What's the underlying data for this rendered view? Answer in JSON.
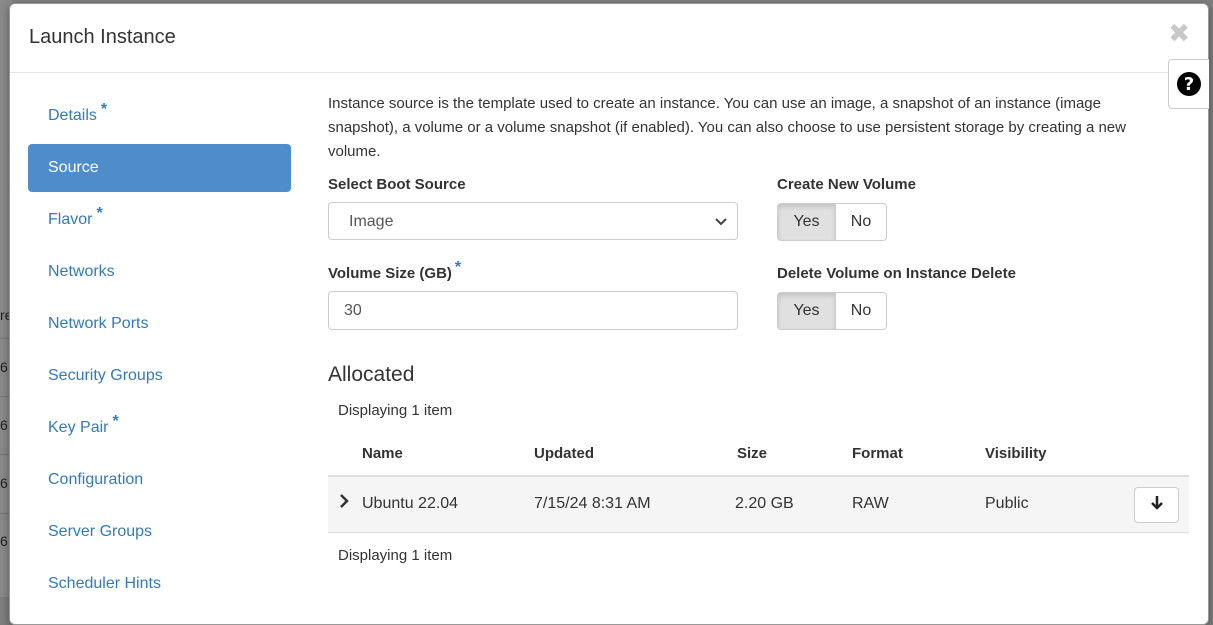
{
  "background": {
    "fragments": [
      "re",
      "6.",
      "6.",
      "6.",
      "6."
    ]
  },
  "modal": {
    "title": "Launch Instance",
    "close_glyph": "✖",
    "help_glyph": "?"
  },
  "nav": {
    "items": [
      {
        "label": "Details",
        "required": "*"
      },
      {
        "label": "Source",
        "required": ""
      },
      {
        "label": "Flavor",
        "required": "*"
      },
      {
        "label": "Networks",
        "required": ""
      },
      {
        "label": "Network Ports",
        "required": ""
      },
      {
        "label": "Security Groups",
        "required": ""
      },
      {
        "label": "Key Pair",
        "required": "*"
      },
      {
        "label": "Configuration",
        "required": ""
      },
      {
        "label": "Server Groups",
        "required": ""
      },
      {
        "label": "Scheduler Hints",
        "required": ""
      }
    ],
    "active": "Source"
  },
  "source": {
    "intro": "Instance source is the template used to create an instance. You can use an image, a snapshot of an instance (image snapshot), a volume or a volume snapshot (if enabled). You can also choose to use persistent storage by creating a new volume.",
    "boot_source_label": "Select Boot Source",
    "boot_source_value": "Image",
    "create_volume_label": "Create New Volume",
    "volume_size_label": "Volume Size (GB)",
    "volume_size_required": "*",
    "volume_size_value": "30",
    "delete_volume_label": "Delete Volume on Instance Delete",
    "yes_label": "Yes",
    "no_label": "No",
    "create_volume_selected": "Yes",
    "delete_volume_selected": "Yes"
  },
  "allocated": {
    "title": "Allocated",
    "displaying_top": "Displaying 1 item",
    "displaying_bottom": "Displaying 1 item",
    "columns": [
      "Name",
      "Updated",
      "Size",
      "Format",
      "Visibility"
    ],
    "rows": [
      {
        "name": "Ubuntu 22.04",
        "updated": "7/15/24 8:31 AM",
        "size": "2.20 GB",
        "format": "RAW",
        "visibility": "Public"
      }
    ]
  },
  "colors": {
    "accent": "#337ab7",
    "active_nav": "#4e8ccb"
  }
}
